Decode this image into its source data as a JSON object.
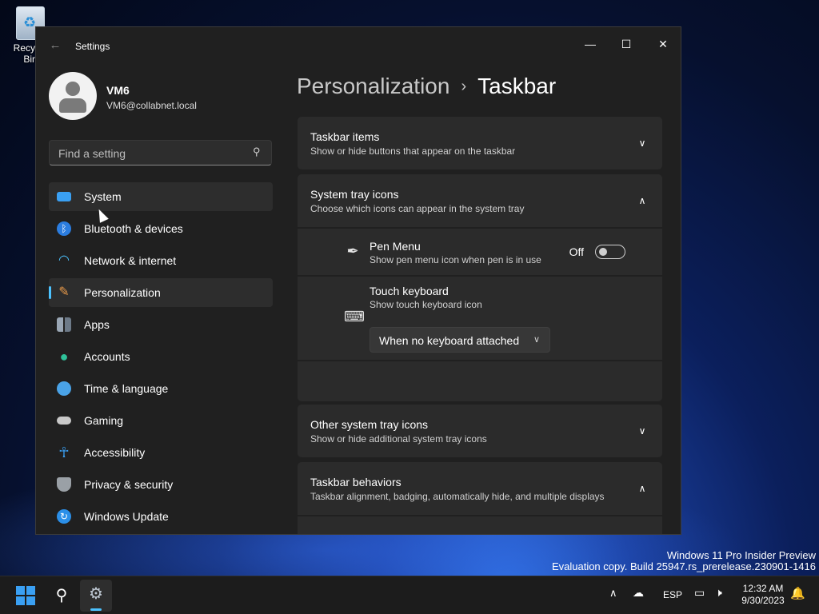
{
  "desktop": {
    "recycle_bin_label": "Recycle Bin"
  },
  "window": {
    "title": "Settings",
    "controls": {
      "minimize": "—",
      "maximize": "☐",
      "close": "✕",
      "back": "←"
    }
  },
  "user": {
    "name": "VM6",
    "email": "VM6@collabnet.local"
  },
  "search": {
    "placeholder": "Find a setting"
  },
  "nav": [
    {
      "label": "System",
      "icon": "system-icon",
      "color": "#3aa0f3"
    },
    {
      "label": "Bluetooth & devices",
      "icon": "bluetooth-icon",
      "color": "#2b7de0"
    },
    {
      "label": "Network & internet",
      "icon": "wifi-icon",
      "color": "#4cc2ff"
    },
    {
      "label": "Personalization",
      "icon": "brush-icon",
      "color": "#e89a4a"
    },
    {
      "label": "Apps",
      "icon": "apps-icon",
      "color": "#9aa7b5"
    },
    {
      "label": "Accounts",
      "icon": "person-icon",
      "color": "#2fc29a"
    },
    {
      "label": "Time & language",
      "icon": "globe-clock-icon",
      "color": "#4aa3e8"
    },
    {
      "label": "Gaming",
      "icon": "gamepad-icon",
      "color": "#c8c8c8"
    },
    {
      "label": "Accessibility",
      "icon": "accessibility-icon",
      "color": "#3aa0f3"
    },
    {
      "label": "Privacy & security",
      "icon": "shield-icon",
      "color": "#9aa0a6"
    },
    {
      "label": "Windows Update",
      "icon": "update-icon",
      "color": "#2b8fe8"
    }
  ],
  "breadcrumb": {
    "parent": "Personalization",
    "separator": "›",
    "current": "Taskbar"
  },
  "sections": {
    "taskbar_items": {
      "title": "Taskbar items",
      "subtitle": "Show or hide buttons that appear on the taskbar"
    },
    "system_tray": {
      "title": "System tray icons",
      "subtitle": "Choose which icons can appear in the system tray"
    },
    "pen_menu": {
      "title": "Pen Menu",
      "subtitle": "Show pen menu icon when pen is in use",
      "state_label": "Off"
    },
    "touch_keyboard": {
      "title": "Touch keyboard",
      "subtitle": "Show touch keyboard icon",
      "dropdown_value": "When no keyboard attached"
    },
    "other_tray": {
      "title": "Other system tray icons",
      "subtitle": "Show or hide additional system tray icons"
    },
    "behaviors": {
      "title": "Taskbar behaviors",
      "subtitle": "Taskbar alignment, badging, automatically hide, and multiple displays"
    }
  },
  "watermark": {
    "line1": "Windows 11 Pro Insider Preview",
    "line2": "Evaluation copy. Build 25947.rs_prerelease.230901-1416"
  },
  "taskbar": {
    "language": "ESP",
    "time": "12:32 AM",
    "date": "9/30/2023"
  }
}
